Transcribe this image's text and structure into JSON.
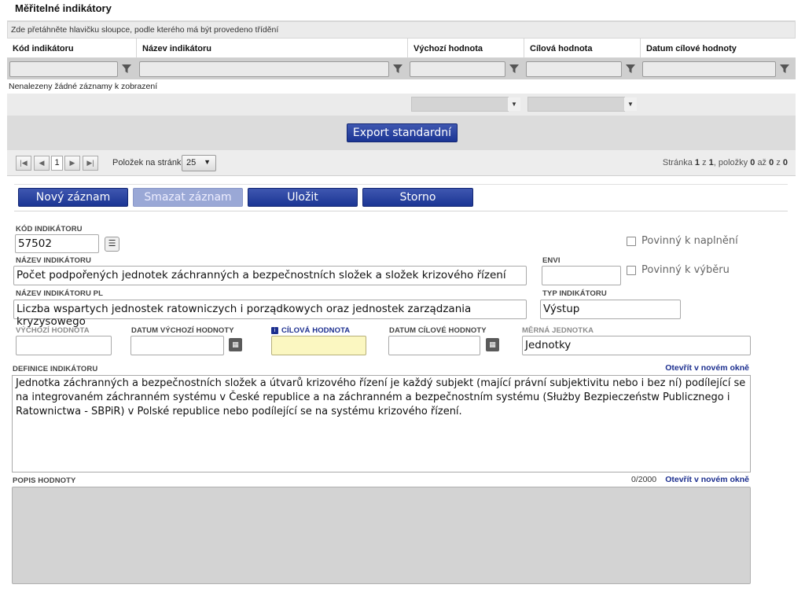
{
  "section": {
    "title": "Měřitelné indikátory"
  },
  "grid": {
    "group_hint": "Zde přetáhněte hlavičku sloupce, podle kterého má být provedeno třídění",
    "columns": [
      "Kód indikátoru",
      "Název indikátoru",
      "Výchozí hodnota",
      "Cílová hodnota",
      "Datum cílové hodnoty"
    ],
    "empty_message": "Nenalezeny žádné záznamy k zobrazení",
    "export_label": "Export standardní"
  },
  "pager": {
    "current_page": "1",
    "per_page_label": "Položek na stránku",
    "per_page_value": "25",
    "info_prefix": "Stránka",
    "page": "1",
    "of_label": "z",
    "total_pages": "1",
    "items_label": ", položky",
    "from": "0",
    "to_label": "až",
    "to": "0",
    "total_label": "z",
    "total": "0"
  },
  "actions": {
    "new_record": "Nový záznam",
    "delete_record": "Smazat záznam",
    "save": "Uložit",
    "cancel": "Storno"
  },
  "form": {
    "kod": {
      "label": "Kód indikátoru",
      "value": "57502"
    },
    "nazev": {
      "label": "Název indikátoru",
      "value": "Počet podpořených jednotek záchranných a bezpečnostních složek a složek krizového řízení"
    },
    "envi": {
      "label": "Envi",
      "value": ""
    },
    "nazev_pl": {
      "label": "Název indikátoru PL",
      "value": "Liczba wspartych jednostek ratowniczych i porządkowych oraz jednostek zarządzania kryzysowego"
    },
    "typ": {
      "label": "Typ indikátoru",
      "value": "Výstup"
    },
    "povinny_naplneni": {
      "label": "Povinný k naplnění",
      "checked": false
    },
    "povinny_vyberu": {
      "label": "Povinný k výběru",
      "checked": false
    },
    "vychozi": {
      "label": "Výchozí hodnota",
      "value": ""
    },
    "datum_vychozi": {
      "label": "Datum výchozí hodnoty",
      "value": ""
    },
    "cilova": {
      "label": "Cílová hodnota",
      "value": ""
    },
    "datum_cilove": {
      "label": "Datum cílové hodnoty",
      "value": ""
    },
    "merna": {
      "label": "Měrná jednotka",
      "value": "Jednotky"
    },
    "definice": {
      "label": "Definice indikátoru",
      "open_link": "Otevřít v novém okně",
      "value": "Jednotka záchranných a bezpečnostních složek a útvarů krizového řízení je každý subjekt (mající právní subjektivitu nebo i bez ní) podílející se na integrovaném záchranném systému v České republice a na záchranném a bezpečnostním systému (Służby Bezpieczeństw Publicznego i Ratownictwa - SBPiR) v Polské republice nebo podílející se na systému krizového řízení."
    },
    "popis": {
      "label": "Popis hodnoty",
      "counter": "0/2000",
      "open_link": "Otevřít v novém okně",
      "value": ""
    }
  },
  "colors": {
    "accent": "#1c2f8f",
    "required_field": "#fbf7c1"
  }
}
